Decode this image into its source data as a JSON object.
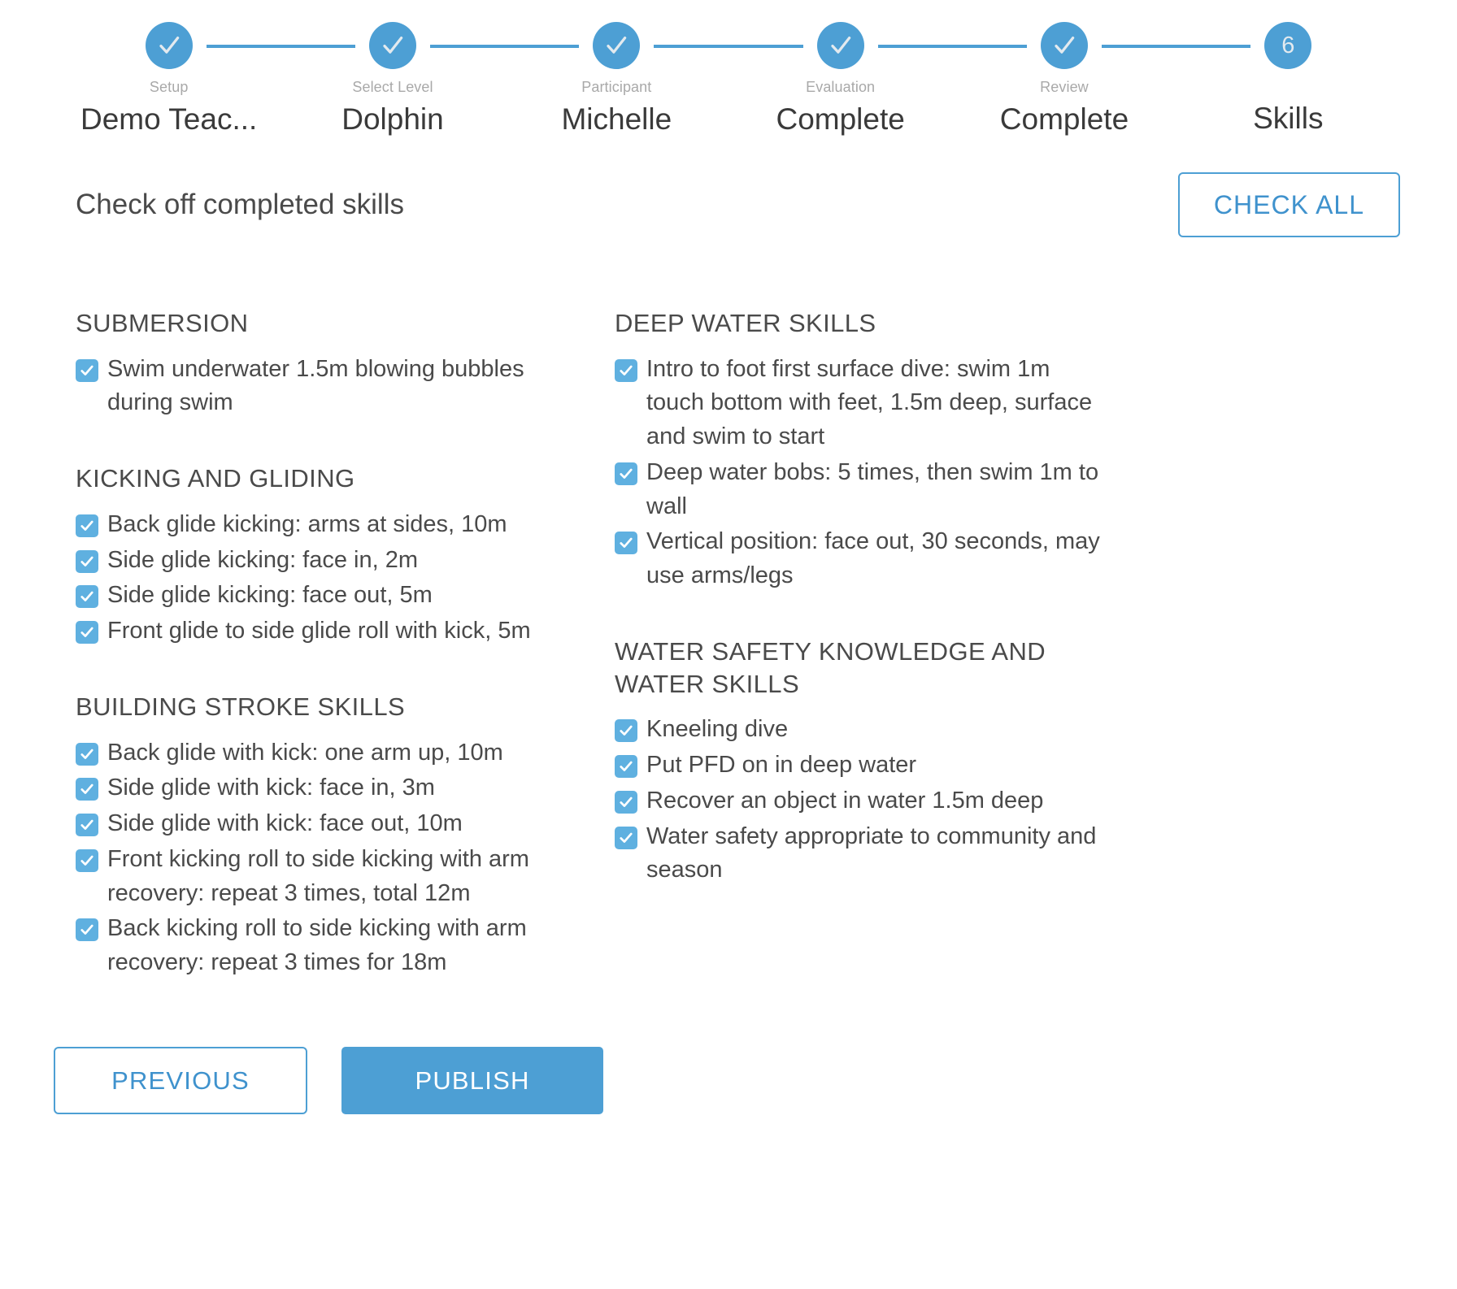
{
  "colors": {
    "accent": "#4d9fd4",
    "checkbox": "#5fb0e0",
    "text": "#4a4a4a",
    "muted": "#a9a9a9"
  },
  "stepper": {
    "steps": [
      {
        "sublabel": "Setup",
        "value": "Demo Teac...",
        "state": "complete",
        "badge": "✓"
      },
      {
        "sublabel": "Select Level",
        "value": "Dolphin",
        "state": "complete",
        "badge": "✓"
      },
      {
        "sublabel": "Participant",
        "value": "Michelle",
        "state": "complete",
        "badge": "✓"
      },
      {
        "sublabel": "Evaluation",
        "value": "Complete",
        "state": "complete",
        "badge": "✓"
      },
      {
        "sublabel": "Review",
        "value": "Complete",
        "state": "complete",
        "badge": "✓"
      },
      {
        "sublabel": "",
        "value": "Skills",
        "state": "current",
        "badge": "6"
      }
    ]
  },
  "header": {
    "title": "Check off completed skills",
    "check_all_label": "CHECK ALL"
  },
  "columns": {
    "left": [
      {
        "title": "SUBMERSION",
        "skills": [
          {
            "label": "Swim underwater 1.5m blowing bubbles during swim",
            "checked": true
          }
        ]
      },
      {
        "title": "KICKING AND GLIDING",
        "skills": [
          {
            "label": "Back glide kicking: arms at sides, 10m",
            "checked": true
          },
          {
            "label": "Side glide kicking: face in, 2m",
            "checked": true
          },
          {
            "label": "Side glide kicking: face out, 5m",
            "checked": true
          },
          {
            "label": "Front glide to side glide roll with kick, 5m",
            "checked": true
          }
        ]
      },
      {
        "title": "BUILDING STROKE SKILLS",
        "skills": [
          {
            "label": "Back glide with kick: one arm up, 10m",
            "checked": true
          },
          {
            "label": "Side glide with kick: face in, 3m",
            "checked": true
          },
          {
            "label": "Side glide with kick: face out, 10m",
            "checked": true
          },
          {
            "label": "Front kicking roll to side kicking with arm recovery: repeat 3 times, total 12m",
            "checked": true
          },
          {
            "label": "Back kicking roll to side kicking with arm recovery: repeat 3 times for 18m",
            "checked": true
          }
        ]
      }
    ],
    "right": [
      {
        "title": "DEEP WATER SKILLS",
        "skills": [
          {
            "label": "Intro to foot first surface dive: swim 1m touch bottom with feet, 1.5m deep, surface and swim to start",
            "checked": true
          },
          {
            "label": "Deep water bobs: 5 times, then swim 1m to wall",
            "checked": true
          },
          {
            "label": "Vertical position: face out, 30 seconds, may use arms/legs",
            "checked": true
          }
        ]
      },
      {
        "title": "WATER SAFETY KNOWLEDGE AND WATER SKILLS",
        "skills": [
          {
            "label": "Kneeling dive",
            "checked": true
          },
          {
            "label": "Put PFD on in deep water",
            "checked": true
          },
          {
            "label": "Recover an object in water 1.5m deep",
            "checked": true
          },
          {
            "label": "Water safety appropriate to community and season",
            "checked": true
          }
        ]
      }
    ]
  },
  "footer": {
    "previous_label": "PREVIOUS",
    "publish_label": "PUBLISH"
  }
}
